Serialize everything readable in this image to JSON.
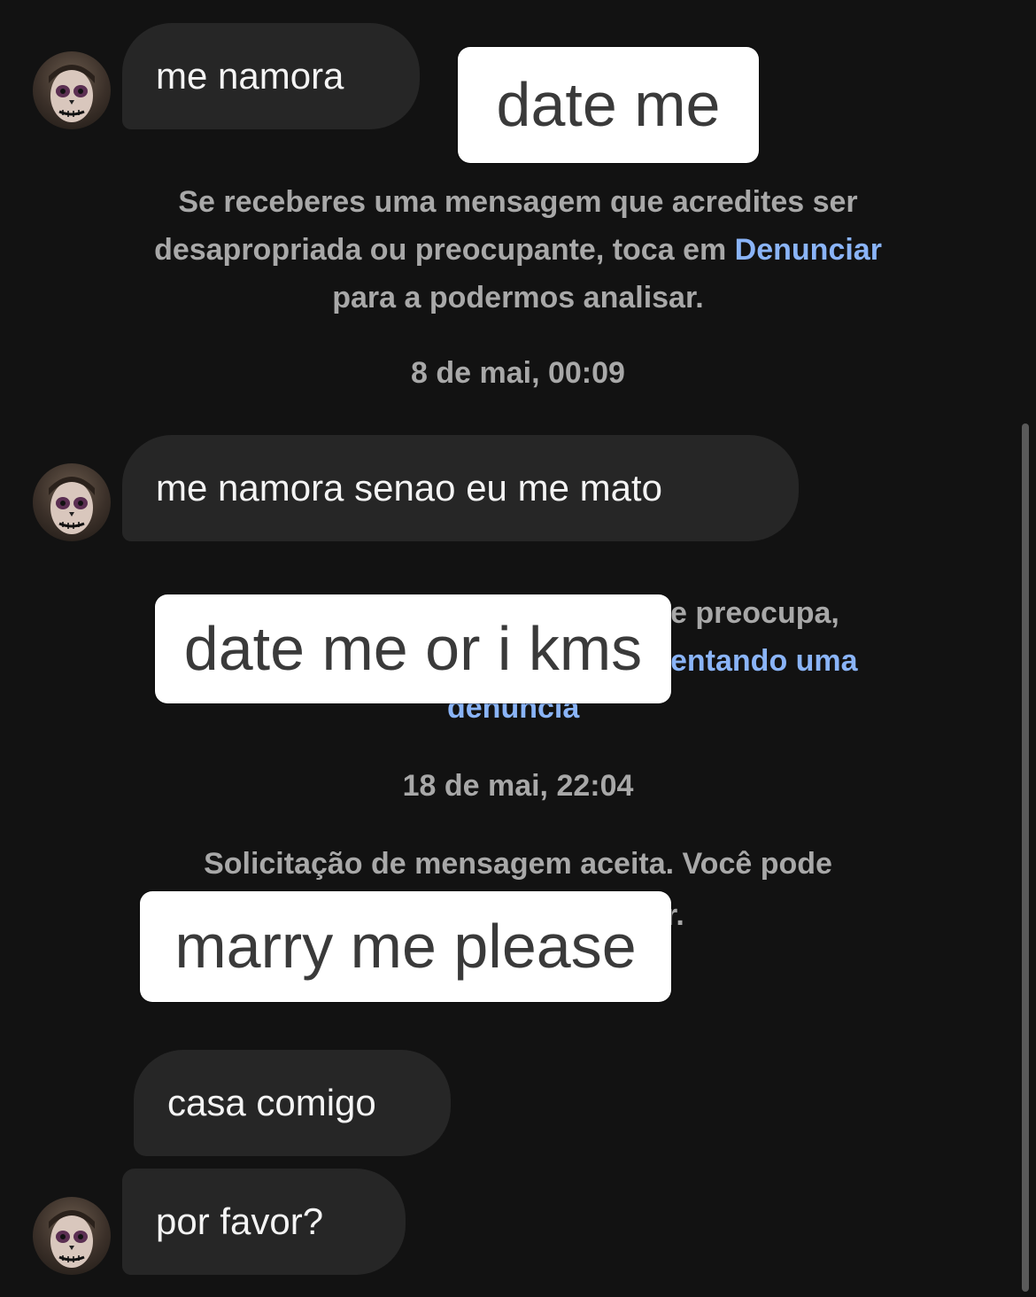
{
  "messages": [
    {
      "text": "me namora"
    },
    {
      "text": "me namora senao eu me mato"
    },
    {
      "text": "casa comigo"
    },
    {
      "text": "por favor?"
    }
  ],
  "notices": {
    "report_notice": {
      "before_link": "Se receberes uma mensagem que acredites ser desapropriada ou preocupante, toca em ",
      "link": "Denunciar",
      "after_link": " para a podermos analisar."
    },
    "partial_notice": {
      "line1_tail": "e preocupa,",
      "line2_tail": "entando uma",
      "line3": "denúncia"
    },
    "accepted_notice": {
      "line1": "Solicitação de mensagem aceita. Você pode",
      "line2_tail": "r."
    }
  },
  "timestamps": {
    "first": "8 de mai, 00:09",
    "second": "18 de mai, 22:04"
  },
  "captions": {
    "first": "date me",
    "second": "date me or i kms",
    "third": "marry me please"
  },
  "avatar": {
    "icon": "skull-face-avatar-icon"
  },
  "colors": {
    "background": "#121212",
    "bubble": "#262626",
    "link": "#8ab4f8",
    "muted_text": "#a8a8a8"
  }
}
